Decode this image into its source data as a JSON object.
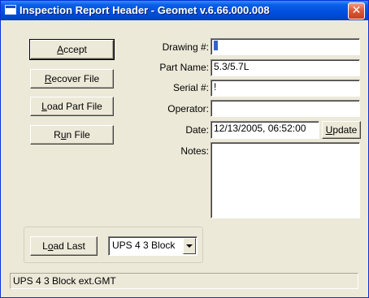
{
  "window": {
    "title": "Inspection Report Header - Geomet v.6.66.000.008",
    "close_glyph": "✕"
  },
  "buttons": {
    "accept": {
      "label": "Accept",
      "mnemonic": "A",
      "rest": "ccept"
    },
    "recover": {
      "label": "Recover File",
      "mnemonic": "R",
      "rest": "ecover File"
    },
    "load_part": {
      "label": "Load Part File",
      "mnemonic": "L",
      "rest": "oad Part File"
    },
    "run": {
      "label": "Run File",
      "pre": "R",
      "mnemonic": "u",
      "rest": "n File"
    },
    "update": {
      "label": "Update",
      "mnemonic": "U",
      "rest": "pdate"
    },
    "load_last": {
      "label": "Load Last",
      "pre": "L",
      "mnemonic": "o",
      "rest": "ad Last"
    }
  },
  "form": {
    "drawing": {
      "label": "Drawing #:",
      "value": ""
    },
    "part_name": {
      "label": "Part Name:",
      "value": "5.3/5.7L"
    },
    "serial": {
      "label": "Serial #:",
      "value": "!"
    },
    "operator": {
      "label": "Operator:",
      "value": ""
    },
    "date": {
      "label": "Date:",
      "value": "12/13/2005, 06:52:00"
    },
    "notes": {
      "label": "Notes:",
      "value": ""
    }
  },
  "last_selector": {
    "selected": "UPS 4 3 Block"
  },
  "status": {
    "text": "UPS 4 3 Block ext.GMT"
  },
  "icons": {
    "window_icon": "window-icon",
    "close": "close-icon",
    "dropdown_arrow": "chevron-down-icon"
  },
  "colors": {
    "titlebar": "#0050e0",
    "face": "#ece9d8",
    "close": "#e05a3a",
    "caret": "#3a5fcd"
  }
}
